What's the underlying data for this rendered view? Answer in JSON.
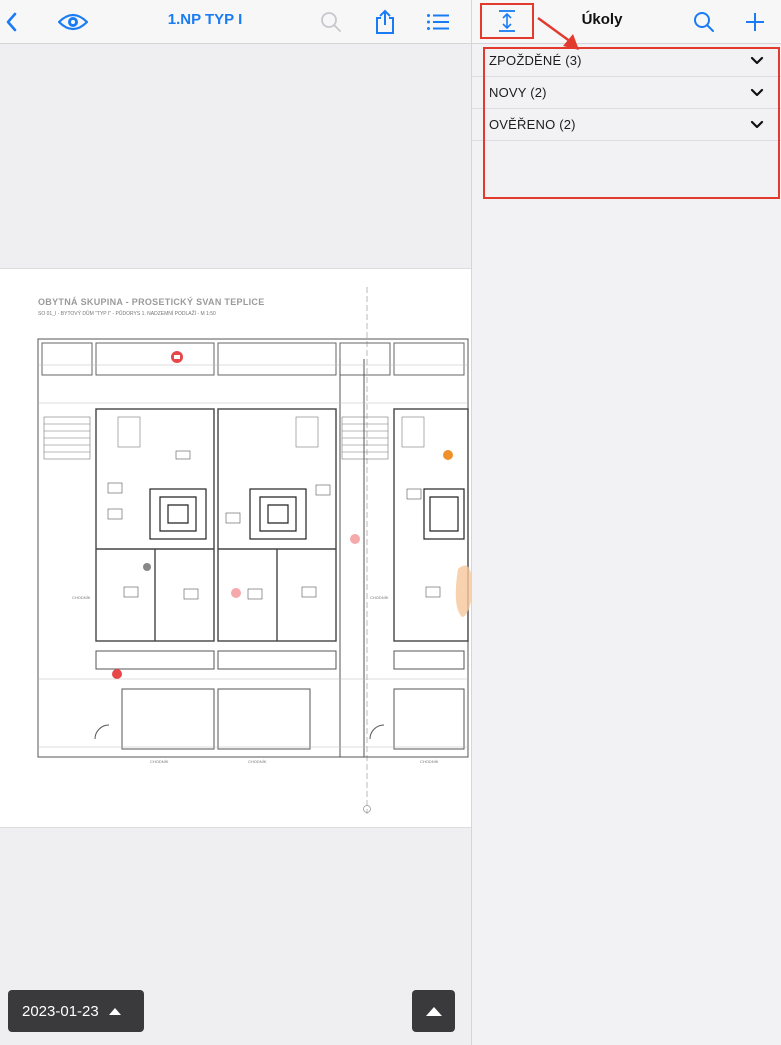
{
  "left_toolbar": {
    "doc_title": "1.NP TYP I",
    "icons": [
      "back-chevron-icon",
      "eye-icon",
      "search-icon",
      "share-icon",
      "list-icon"
    ]
  },
  "drawing": {
    "title": "OBYTNÁ SKUPINA - PROSETICKÝ SVAN TEPLICE",
    "subtitle": "SO 01_I - BYTOVÝ DŮM \"TYP I\" - PŮDORYS 1. NADZEMNÍ PODLAŽÍ - M 1:50"
  },
  "bottom_bar": {
    "date_label": "2023-01-23"
  },
  "right_toolbar": {
    "title": "Úkoly",
    "icons": [
      "collapse-expand-icon",
      "search-icon",
      "plus-icon"
    ]
  },
  "task_groups": [
    {
      "label": "ZPOŽDĚNÉ (3)"
    },
    {
      "label": "NOVY (2)"
    },
    {
      "label": "OVĚŘENO (2)"
    }
  ],
  "colors": {
    "accent": "#1a7cf4",
    "annotation_red": "#e23b2e",
    "pill_bg": "#3a3a3c",
    "pin_red": "#e8474a",
    "pin_orange": "#f0902a"
  }
}
